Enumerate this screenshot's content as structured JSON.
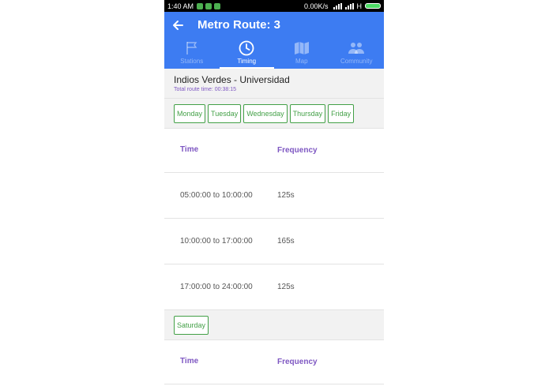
{
  "status_bar": {
    "time": "1:40 AM",
    "net_speed": "0.00K/s",
    "network": "H"
  },
  "app_bar": {
    "title": "Metro Route: 3"
  },
  "tabs": [
    {
      "label": "Stations",
      "icon": "flag-icon",
      "active": false
    },
    {
      "label": "Timing",
      "icon": "clock-icon",
      "active": true
    },
    {
      "label": "Map",
      "icon": "map-icon",
      "active": false
    },
    {
      "label": "Community",
      "icon": "people-icon",
      "active": false
    }
  ],
  "route": {
    "name": "Indios Verdes - Universidad",
    "total_time": "Total route time: 00:38:15"
  },
  "schedules": [
    {
      "days": [
        "Monday",
        "Tuesday",
        "Wednesday",
        "Thursday",
        "Friday"
      ],
      "headers": {
        "time": "Time",
        "frequency": "Frequency"
      },
      "rows": [
        {
          "time": "05:00:00 to 10:00:00",
          "frequency": "125s"
        },
        {
          "time": "10:00:00 to 17:00:00",
          "frequency": "165s"
        },
        {
          "time": "17:00:00 to 24:00:00",
          "frequency": "125s"
        }
      ]
    },
    {
      "days": [
        "Saturday"
      ],
      "headers": {
        "time": "Time",
        "frequency": "Frequency"
      },
      "rows": []
    }
  ],
  "colors": {
    "primary": "#3d7cf2",
    "accent_green": "#43a047",
    "accent_purple": "#7e57c2"
  }
}
